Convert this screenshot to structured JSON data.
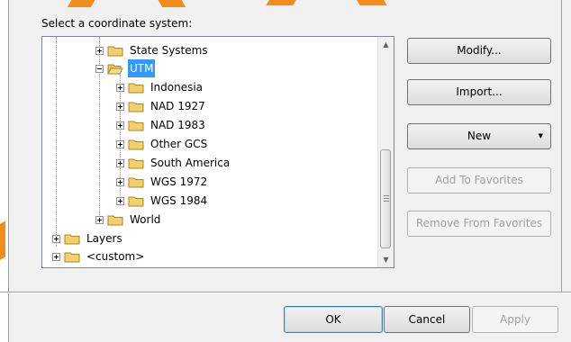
{
  "prompt": "Select a coordinate system:",
  "tree": {
    "state_systems": "State Systems",
    "utm": "UTM",
    "utm_children": [
      "Indonesia",
      "NAD 1927",
      "NAD 1983",
      "Other GCS",
      "South America",
      "WGS 1972",
      "WGS 1984"
    ],
    "world": "World",
    "layers": "Layers",
    "custom": "<custom>"
  },
  "buttons": {
    "modify": "Modify...",
    "import": "Import...",
    "new": "New",
    "add_favorites": "Add To Favorites",
    "remove_favorites": "Remove From Favorites"
  },
  "footer": {
    "ok": "OK",
    "cancel": "Cancel",
    "apply": "Apply"
  },
  "colors": {
    "selection": "#3399ff",
    "folder": "#f2d06b",
    "decor_stripe": "#f28c1b"
  },
  "icons": [
    "folder-icon",
    "open-folder-icon",
    "expand-icon",
    "collapse-icon",
    "dropdown-arrow-icon"
  ]
}
